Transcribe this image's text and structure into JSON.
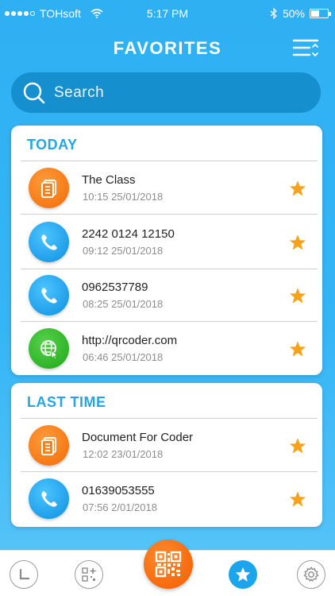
{
  "status_bar": {
    "carrier": "TOHsoft",
    "time": "5:17 PM",
    "battery": "50%",
    "battery_level": 0.5
  },
  "header": {
    "title": "FAVORITES",
    "menu_icon": "sort-menu-icon"
  },
  "search": {
    "placeholder": "Search",
    "icon": "search-icon"
  },
  "sections": [
    {
      "title": "TODAY",
      "items": [
        {
          "icon": "document-icon",
          "title": "The Class",
          "time": "10:15 25/01/2018",
          "favorite": true
        },
        {
          "icon": "phone-icon",
          "title": "2242 0124 12150",
          "time": "09:12 25/01/2018",
          "favorite": true
        },
        {
          "icon": "phone-icon",
          "title": "0962537789",
          "time": "08:25 25/01/2018",
          "favorite": true
        },
        {
          "icon": "globe-icon",
          "title": "http://qrcoder.com",
          "time": "06:46 25/01/2018",
          "favorite": true
        }
      ]
    },
    {
      "title": "LAST TIME",
      "items": [
        {
          "icon": "document-icon",
          "title": "Document For Coder",
          "time": "12:02 23/01/2018",
          "favorite": true
        },
        {
          "icon": "phone-icon",
          "title": "01639053555",
          "time": "07:56 2/01/2018",
          "favorite": true
        }
      ]
    }
  ],
  "bottom_nav": {
    "tabs": [
      "history-icon",
      "create-qr-icon",
      "scan-qr-icon",
      "favorites-star-icon",
      "settings-gear-icon"
    ],
    "active": "favorites-star-icon"
  },
  "colors": {
    "background": "#2fb0f3",
    "accent": "#22a7e6",
    "star": "#f7a21b",
    "doc": "#f26b06",
    "phone": "#0d8fe0",
    "web": "#1ea81a"
  }
}
